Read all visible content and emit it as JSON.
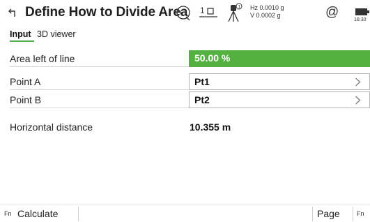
{
  "header": {
    "title": "Define How to Divide Area",
    "layer_number": "1",
    "hz": "Hz 0.0010 g",
    "v": "V  0.0002 g",
    "at_symbol": "@",
    "clock": "16:30",
    "icons": [
      "back-icon",
      "tilt-icon",
      "layer-icon",
      "tripod-icon",
      "at-icon",
      "battery-icon"
    ]
  },
  "tabs": {
    "input": "Input",
    "viewer": "3D viewer",
    "active": "Input"
  },
  "form": {
    "area_label": "Area left of line",
    "area_value": "50.00 %",
    "point_a_label": "Point A",
    "point_a_value": "Pt1",
    "point_b_label": "Point B",
    "point_b_value": "Pt2",
    "distance_label": "Horizontal distance",
    "distance_value": "10.355 m"
  },
  "footer": {
    "fn_left": "Fn",
    "calculate": "Calculate",
    "page": "Page",
    "fn_right": "Fn"
  },
  "colors": {
    "accent_green": "#53b141",
    "tab_underline": "#4ca64c"
  }
}
